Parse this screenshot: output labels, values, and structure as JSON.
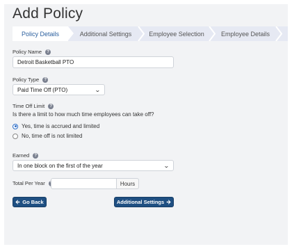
{
  "page": {
    "title": "Add Policy"
  },
  "wizard": {
    "steps": [
      {
        "label": "Policy Details",
        "active": true
      },
      {
        "label": "Additional Settings",
        "active": false
      },
      {
        "label": "Employee Selection",
        "active": false
      },
      {
        "label": "Employee Details",
        "active": false
      }
    ]
  },
  "form": {
    "policy_name": {
      "label": "Policy Name",
      "value": "Detroit Basketball PTO"
    },
    "policy_type": {
      "label": "Policy Type",
      "value": "Paid Time Off (PTO)"
    },
    "time_off_limit": {
      "label": "Time Off Limit",
      "question": "Is there a limit to how much time employees can take off?",
      "options": [
        {
          "label": "Yes, time is accrued and limited",
          "checked": true
        },
        {
          "label": "No, time off is not limited",
          "checked": false
        }
      ]
    },
    "earned": {
      "label": "Earned",
      "value": "In one block on the first of the year"
    },
    "total_per_year": {
      "label": "Total Per Year",
      "value": "",
      "unit": "Hours"
    }
  },
  "buttons": {
    "back": "Go Back",
    "next": "Additional Settings"
  },
  "icons": {
    "help": "question-circle-icon",
    "back": "arrow-left-icon",
    "next": "arrow-right-icon",
    "dropdown": "chevron-down-icon"
  },
  "colors": {
    "primary_button": "#1f4f82",
    "active_step_text": "#2a5f9e",
    "step_bar": "#e6e9f3"
  }
}
